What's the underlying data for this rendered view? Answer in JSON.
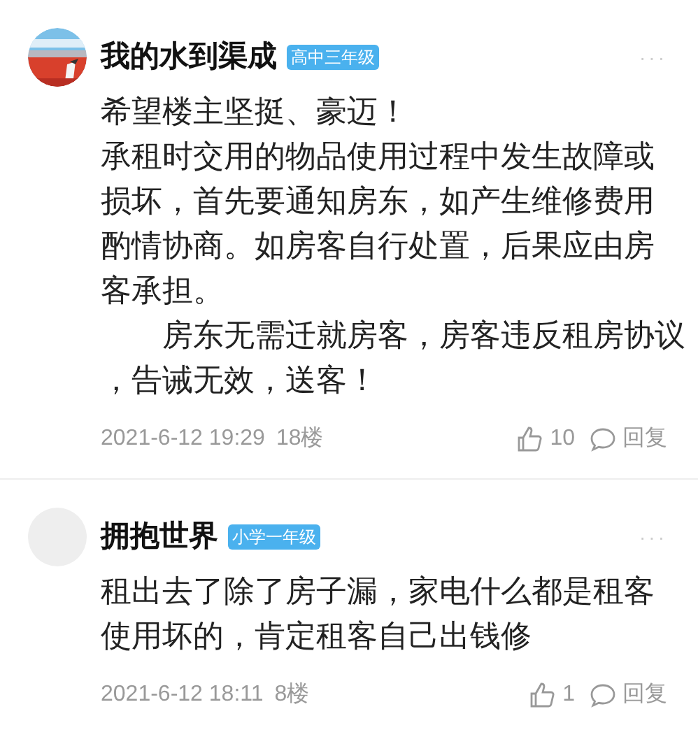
{
  "comments": [
    {
      "name": "我的水到渠成",
      "badge": "高中三年级",
      "more": "···",
      "lines": [
        "希望楼主坚挺、豪迈！",
        "承租时交用的物品使用过程中发生故障或",
        "损坏，首先要通知房东，如产生维修费用",
        "酌情协商。如房客自行处置，后果应由房",
        "客承担。",
        "　　房东无需迁就房客，房客违反租房协议",
        "，告诫无效，送客！"
      ],
      "time": "2021-6-12 19:29",
      "floor": "18楼",
      "likes": "10",
      "reply": "回复"
    },
    {
      "avatar": {
        "kind": "blank"
      },
      "name": "拥抱世界",
      "badge": "小学一年级",
      "more": "···",
      "lines": [
        "租出去了除了房子漏，家电什么都是租客",
        "使用坏的，肯定租客自己出钱修"
      ],
      "time": "2021-6-12 18:11",
      "floor": "8楼",
      "likes": "1",
      "reply": "回复"
    }
  ]
}
